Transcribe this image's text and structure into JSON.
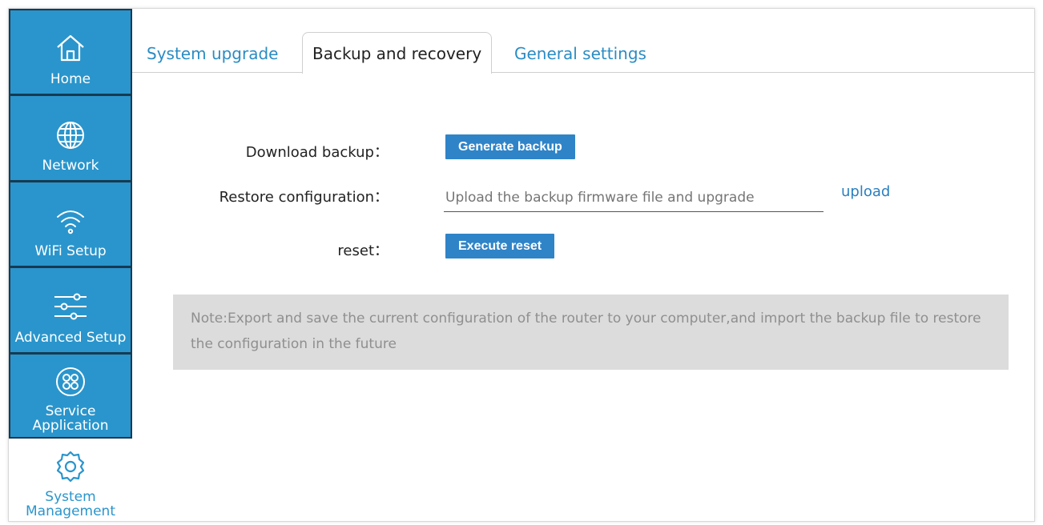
{
  "sidebar": {
    "items": [
      {
        "label": "Home",
        "icon": "home-icon"
      },
      {
        "label": "Network",
        "icon": "globe-icon"
      },
      {
        "label": "WiFi Setup",
        "icon": "wifi-icon"
      },
      {
        "label": "Advanced Setup",
        "icon": "sliders-icon"
      },
      {
        "label": "Service Application",
        "icon": "apps-icon"
      },
      {
        "label": "System Management",
        "icon": "gear-icon"
      }
    ]
  },
  "tabs": [
    {
      "label": "System upgrade"
    },
    {
      "label": "Backup and recovery"
    },
    {
      "label": "General settings"
    }
  ],
  "form": {
    "download_label": "Download backup：",
    "generate_button": "Generate backup",
    "restore_label": "Restore configuration：",
    "file_placeholder": "Upload the backup firmware file and upgrade",
    "upload_link": "upload",
    "reset_label": "reset：",
    "reset_button": "Execute reset"
  },
  "note": "Note:Export and save the current configuration of the router to your computer,and import the backup file to restore the configuration in the future",
  "colors": {
    "sidebar_blue": "#2a95cc",
    "button_blue": "#2f84c8",
    "link_blue": "#2a8cc4",
    "note_bg": "#dcdcdc"
  }
}
